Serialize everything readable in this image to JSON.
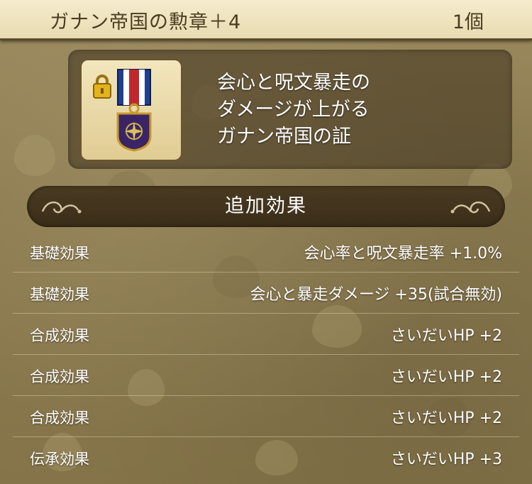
{
  "header": {
    "item_name": "ガナン帝国の勲章＋4",
    "count": "1個"
  },
  "item": {
    "icon": "medal-icon",
    "locked": true,
    "lock_icon": "lock-icon",
    "description_lines": [
      "会心と呪文暴走の",
      "ダメージが上がる",
      "ガナン帝国の証"
    ]
  },
  "section": {
    "title": "追加効果"
  },
  "effects": [
    {
      "type": "基礎効果",
      "value": "会心率と呪文暴走率 +1.0%"
    },
    {
      "type": "基礎効果",
      "value": "会心と暴走ダメージ +35(試合無効)"
    },
    {
      "type": "合成効果",
      "value": "さいだいHP +2"
    },
    {
      "type": "合成効果",
      "value": "さいだいHP +2"
    },
    {
      "type": "合成効果",
      "value": "さいだいHP +2"
    },
    {
      "type": "伝承効果",
      "value": "さいだいHP +3"
    }
  ],
  "colors": {
    "header_bg": "#f6eccd",
    "header_text": "#4a3c22",
    "panel_bg": "#3a2d18",
    "medal_ribbon_blue": "#1f3f8f",
    "medal_ribbon_red": "#c0282d",
    "medal_body_purple": "#3b2466",
    "lock_gold": "#e4b21a"
  }
}
